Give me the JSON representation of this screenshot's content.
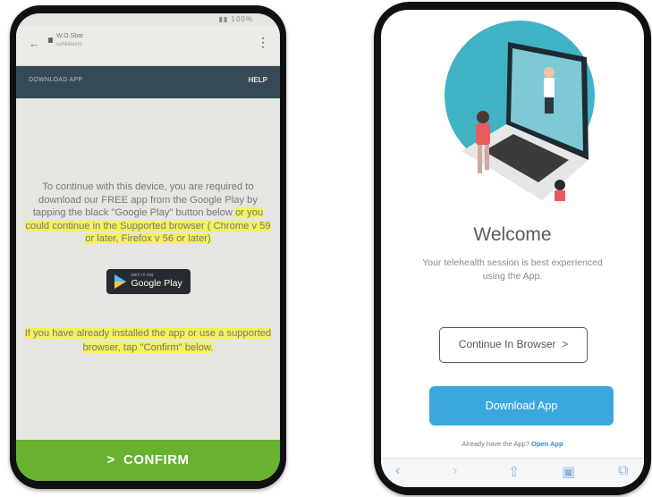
{
  "left_phone": {
    "status_bar": "▮▮ 100%",
    "url_title": "W.O.Sbar",
    "url_sub": "sohkelecm",
    "download_app_label": "DOWNLOAD APP",
    "help_label": "HELP",
    "message_part1": "To continue with this device, you are required to download our FREE app from the Google Play by tapping the black \"Google Play\" button below ",
    "message_part2": "or you could continue in the Supported browser ( Chrome v 59 or later, Firefox v 56 or later)",
    "google_play_get": "GET IT ON",
    "google_play_label": "Google Play",
    "message2": "If you have already installed the app or use a supported browser, tap \"Confirm\" below.",
    "confirm_label": "CONFIRM",
    "confirm_chevron": ">",
    "colors": {
      "highlight": "#f3f25a",
      "confirm": "#67b22f",
      "appbar": "#364a55"
    }
  },
  "right_phone": {
    "welcome_title": "Welcome",
    "subtitle_line1": "Your telehealth session is best experienced",
    "subtitle_line2": "using the App.",
    "continue_browser_label": "Continue In Browser",
    "continue_browser_chevron": ">",
    "download_app_label": "Download App",
    "already_text": "Already have the App?",
    "open_app_label": "Open App",
    "toolbar_icons": [
      "back-icon",
      "forward-icon",
      "share-icon",
      "bookmarks-icon",
      "tabs-icon"
    ],
    "colors": {
      "download": "#3aa8df",
      "hero_circle": "#3fb3c4"
    }
  }
}
